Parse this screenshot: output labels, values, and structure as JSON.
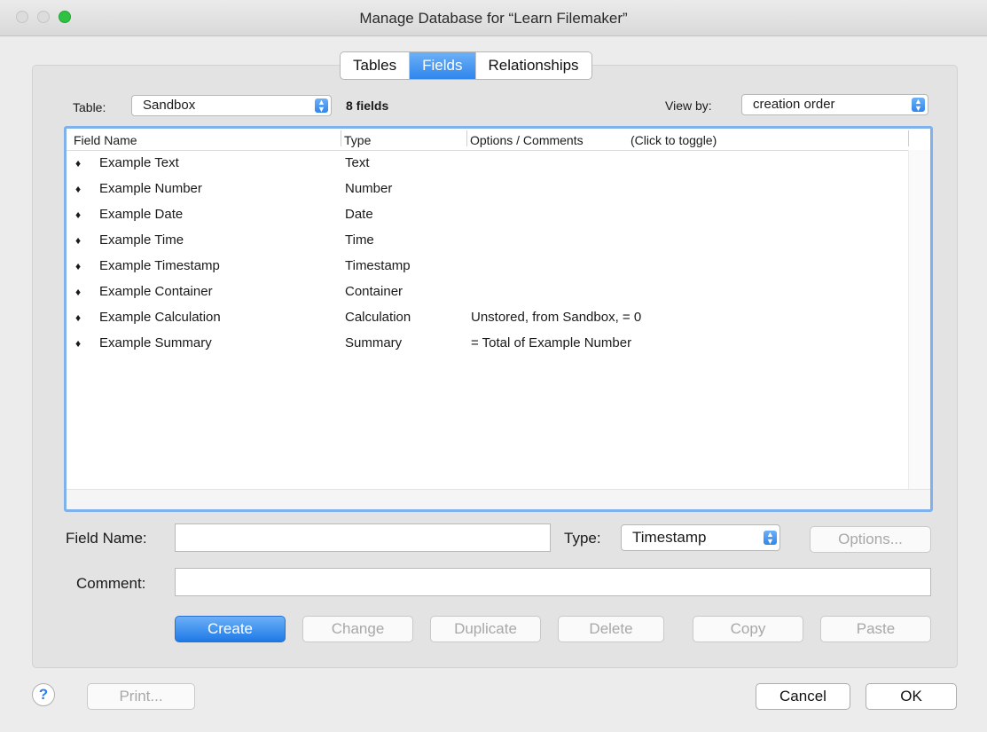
{
  "window": {
    "title": "Manage Database for “Learn Filemaker”"
  },
  "tabs": [
    {
      "label": "Tables",
      "active": false
    },
    {
      "label": "Fields",
      "active": true
    },
    {
      "label": "Relationships",
      "active": false
    }
  ],
  "table_selector": {
    "label": "Table:",
    "value": "Sandbox"
  },
  "field_count": "8 fields",
  "view_by": {
    "label": "View by:",
    "value": "creation order"
  },
  "columns": {
    "name": "Field Name",
    "type": "Type",
    "options": "Options / Comments",
    "toggle_hint": "(Click to toggle)"
  },
  "fields": [
    {
      "handle": "♦",
      "name": "Example Text",
      "type": "Text",
      "options": ""
    },
    {
      "handle": "♦",
      "name": "Example Number",
      "type": "Number",
      "options": ""
    },
    {
      "handle": "♦",
      "name": "Example Date",
      "type": "Date",
      "options": ""
    },
    {
      "handle": "♦",
      "name": "Example Time",
      "type": "Time",
      "options": ""
    },
    {
      "handle": "♦",
      "name": "Example Timestamp",
      "type": "Timestamp",
      "options": ""
    },
    {
      "handle": "♦",
      "name": "Example Container",
      "type": "Container",
      "options": ""
    },
    {
      "handle": "♦",
      "name": "Example Calculation",
      "type": "Calculation",
      "options": "Unstored, from Sandbox, = 0"
    },
    {
      "handle": "♦",
      "name": "Example Summary",
      "type": "Summary",
      "options": "= Total of Example Number"
    }
  ],
  "editor": {
    "field_name_label": "Field Name:",
    "field_name_value": "",
    "type_label": "Type:",
    "type_value": "Timestamp",
    "options_button": "Options...",
    "comment_label": "Comment:",
    "comment_value": ""
  },
  "actions": {
    "create": "Create",
    "change": "Change",
    "duplicate": "Duplicate",
    "delete": "Delete",
    "copy": "Copy",
    "paste": "Paste"
  },
  "footer": {
    "help": "?",
    "print": "Print...",
    "cancel": "Cancel",
    "ok": "OK"
  },
  "colors": {
    "accent": "#2f86ec",
    "focus_ring": "#7fb1ec"
  }
}
